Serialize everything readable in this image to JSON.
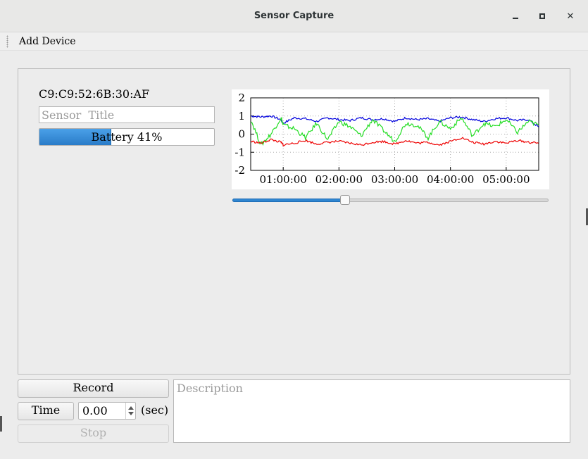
{
  "window": {
    "title": "Sensor Capture",
    "controls": [
      "minimize",
      "maximize",
      "close"
    ]
  },
  "menubar": {
    "items": [
      {
        "label": "Add  Device"
      }
    ]
  },
  "device": {
    "mac_address": "C9:C9:52:6B:30:AF",
    "title_placeholder": "Sensor  Title",
    "title_value": "",
    "battery_label": "Battery  41%",
    "battery_fraction": 0.41
  },
  "timeline_slider": {
    "fraction": 0.357
  },
  "controls": {
    "record_label": "Record",
    "time_label": "Time",
    "time_value": "0.00",
    "time_unit": "(sec)",
    "stop_label": "Stop",
    "description_placeholder": "Description"
  },
  "colors": {
    "series_blue": "#0000dd",
    "series_green": "#22dd22",
    "series_red": "#ee0000",
    "accent": "#2f85d0"
  },
  "chart_data": {
    "type": "line",
    "title": "",
    "xlabel": "",
    "ylabel": "",
    "xlim": [
      "00:25:00",
      "05:35:00"
    ],
    "ylim": [
      -2,
      2
    ],
    "yticks": [
      -2,
      -1,
      0,
      1,
      2
    ],
    "xticks": [
      "01:00:00",
      "02:00:00",
      "03:00:00",
      "04:00:00",
      "05:00:00"
    ],
    "grid": true,
    "legend": "none",
    "x_hours": [
      0.42,
      0.6,
      0.78,
      0.96,
      1.0,
      1.2,
      1.4,
      1.6,
      1.8,
      2.0,
      2.2,
      2.4,
      2.6,
      2.8,
      3.0,
      3.2,
      3.4,
      3.6,
      3.8,
      4.0,
      4.2,
      4.4,
      4.6,
      4.8,
      5.0,
      5.2,
      5.4,
      5.58
    ],
    "series": [
      {
        "color": "blue",
        "values": [
          1.0,
          0.95,
          1.0,
          0.8,
          0.6,
          0.9,
          0.85,
          0.7,
          0.9,
          0.8,
          0.75,
          0.9,
          0.8,
          0.85,
          0.7,
          0.9,
          0.8,
          0.85,
          0.7,
          0.9,
          0.95,
          0.8,
          0.7,
          0.85,
          0.9,
          0.75,
          0.8,
          0.4
        ]
      },
      {
        "color": "green",
        "values": [
          0.8,
          -0.6,
          0.0,
          0.9,
          0.5,
          0.3,
          -0.2,
          0.6,
          -0.3,
          0.7,
          0.4,
          -0.1,
          0.8,
          0.2,
          -0.4,
          0.6,
          0.5,
          -0.2,
          0.7,
          0.3,
          0.9,
          -0.1,
          0.6,
          0.4,
          0.8,
          0.1,
          0.7,
          0.5
        ]
      },
      {
        "color": "red",
        "values": [
          -0.4,
          -0.5,
          -0.3,
          -0.45,
          -0.6,
          -0.5,
          -0.35,
          -0.55,
          -0.45,
          -0.4,
          -0.5,
          -0.6,
          -0.45,
          -0.4,
          -0.55,
          -0.35,
          -0.5,
          -0.45,
          -0.6,
          -0.4,
          -0.2,
          -0.45,
          -0.55,
          -0.4,
          -0.5,
          -0.35,
          -0.45,
          -0.5
        ]
      }
    ]
  }
}
